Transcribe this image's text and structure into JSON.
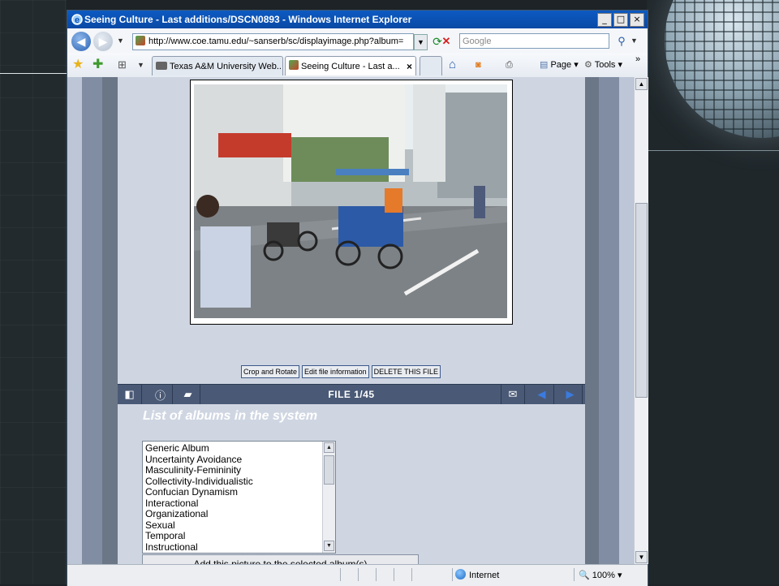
{
  "window": {
    "title": "Seeing Culture - Last additions/DSCN0893 - Windows Internet Explorer",
    "buttons": [
      "_",
      "□",
      "×"
    ]
  },
  "address": {
    "url": "http://www.coe.tamu.edu/~sanserb/sc/displayimage.php?album=",
    "search_placeholder": "Google"
  },
  "tabs": [
    {
      "label": "Texas A&M University Web..."
    },
    {
      "label": "Seeing Culture - Last a...",
      "active": true
    }
  ],
  "commands": {
    "page": "Page",
    "tools": "Tools"
  },
  "photo": {
    "description_icon": "street-photo"
  },
  "actions": [
    "Crop and Rotate",
    "Edit file information",
    "DELETE THIS FILE"
  ],
  "nav": {
    "file_count": "FILE 1/45"
  },
  "albums": {
    "heading": "List of albums in the system",
    "items": [
      "Generic Album",
      "Uncertainty Avoidance",
      "Masculinity-Femininity",
      "Collectivity-Individualistic",
      "Confucian Dynamism",
      "Interactional",
      "Organizational",
      "Sexual",
      "Temporal",
      "Instructional"
    ],
    "add_button": "Add this picture to the selected album(s)"
  },
  "status": {
    "zone": "Internet",
    "zoom": "100%"
  },
  "colors": {
    "titlebar": "#0a4fb5",
    "nav_strip": "#4a5a76",
    "page_bg": "#cfd6e2"
  }
}
